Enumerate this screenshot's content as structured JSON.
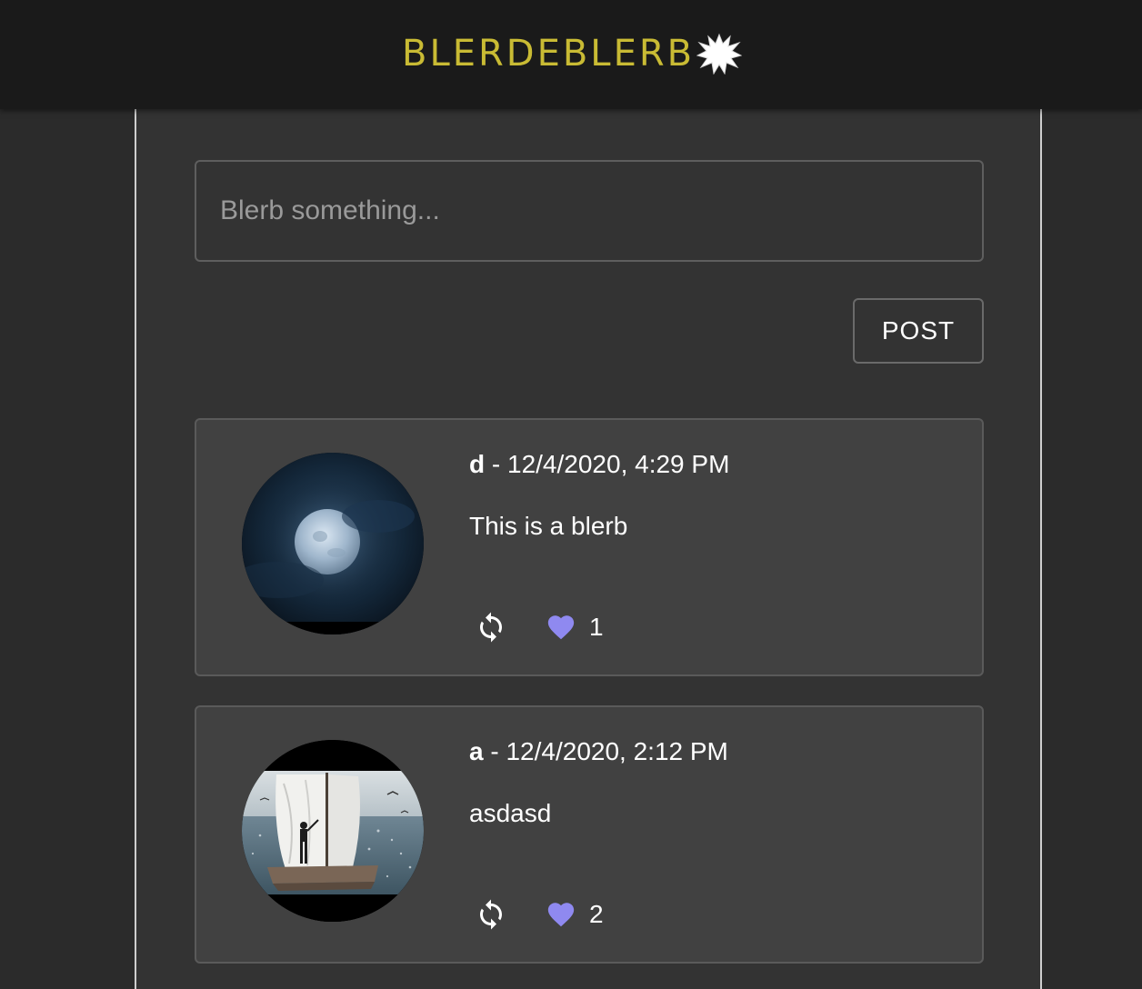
{
  "header": {
    "logo_text": "BLERDEBLERB",
    "logo_burst_icon": "starburst-icon"
  },
  "composer": {
    "placeholder": "Blerb something...",
    "value": "",
    "post_label": "POST"
  },
  "colors": {
    "logo": "#c9bb34",
    "like_heart": "#8f89f0",
    "card_bg": "#414141",
    "page_bg": "#2b2b2b",
    "header_bg": "#1a1a1a"
  },
  "posts": [
    {
      "username": "d",
      "separator": " - ",
      "timestamp": "12/4/2020, 4:29 PM",
      "text": "This is a blerb",
      "likes": "1",
      "avatar": "moon-avatar"
    },
    {
      "username": "a",
      "separator": " - ",
      "timestamp": "12/4/2020, 2:12 PM",
      "text": "asdasd",
      "likes": "2",
      "avatar": "sail-raft-avatar"
    }
  ]
}
